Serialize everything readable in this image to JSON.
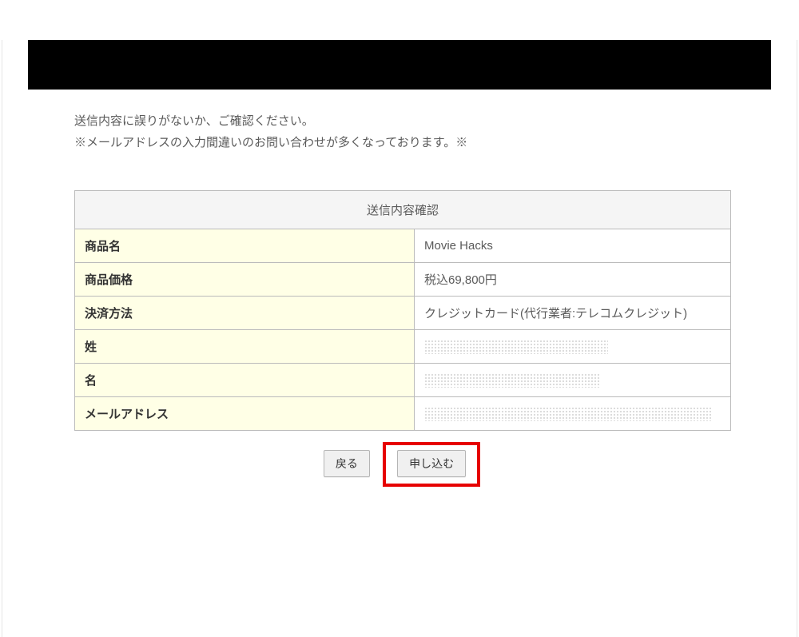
{
  "intro": {
    "line1": "送信内容に誤りがないか、ご確認ください。",
    "line2": "※メールアドレスの入力間違いのお問い合わせが多くなっております。※"
  },
  "table": {
    "title": "送信内容確認",
    "rows": {
      "product_name": {
        "label": "商品名",
        "value": "Movie Hacks"
      },
      "product_price": {
        "label": "商品価格",
        "value": "税込69,800円"
      },
      "payment_method": {
        "label": "決済方法",
        "value": "クレジットカード(代行業者:テレコムクレジット)"
      },
      "last_name": {
        "label": "姓"
      },
      "first_name": {
        "label": "名"
      },
      "email": {
        "label": "メールアドレス"
      }
    }
  },
  "buttons": {
    "back": "戻る",
    "submit": "申し込む"
  }
}
